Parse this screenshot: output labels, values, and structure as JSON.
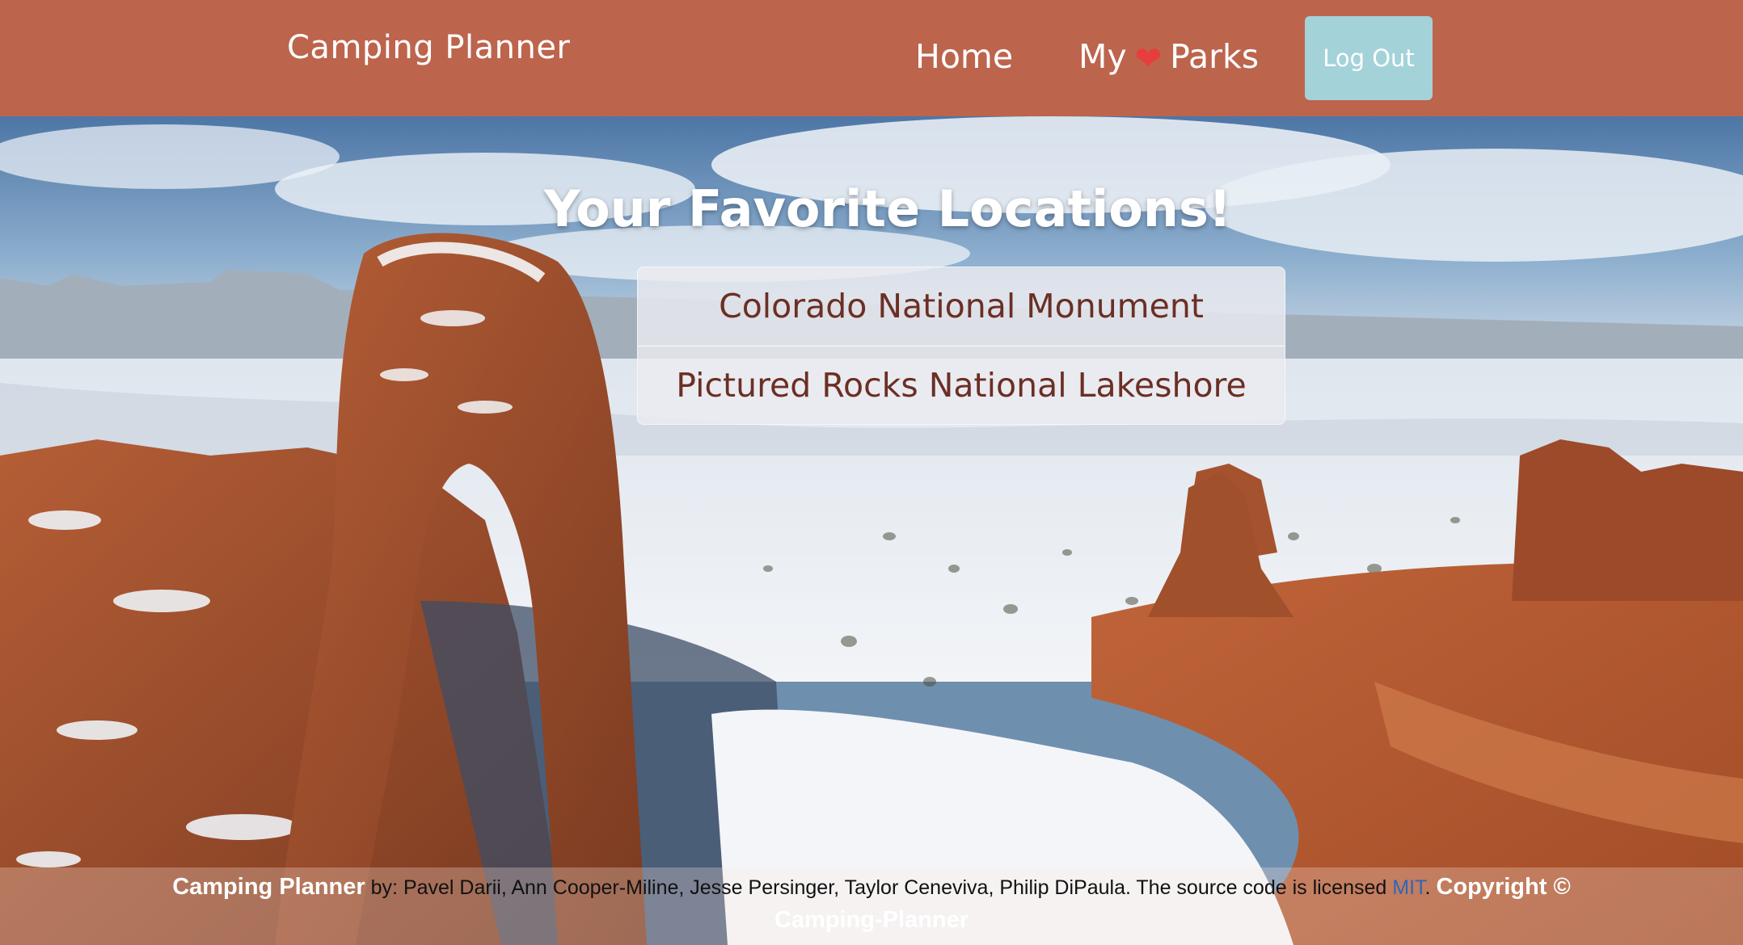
{
  "navbar": {
    "brand": "Camping Planner",
    "home_label": "Home",
    "parks_prefix": "My",
    "parks_suffix": "Parks",
    "logout_label": "Log Out"
  },
  "main": {
    "title": "Your Favorite Locations!",
    "favorites": [
      "Colorado National Monument",
      "Pictured Rocks National Lakeshore"
    ]
  },
  "footer": {
    "brand": "Camping Planner",
    "credits": "by: Pavel Darii, Ann Cooper-Miline, Jesse Persinger, Taylor Ceneviva, Philip DiPaula. The source code is licensed",
    "license_link": "MIT",
    "period": ".",
    "copyright": "Copyright ©",
    "copyright_owner": "Camping-Planner"
  },
  "colors": {
    "navbar": "#bd644d",
    "logout": "#a4d2d9",
    "favorite_text": "#6b2f24",
    "heart": "#e83d3d",
    "link": "#2f66b8"
  },
  "icons": {
    "heart": "heart-icon"
  }
}
